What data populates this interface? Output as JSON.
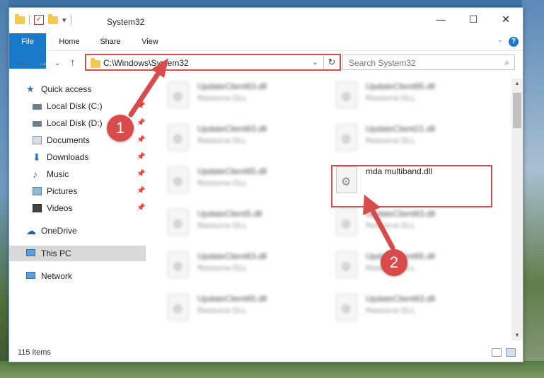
{
  "window": {
    "title": "System32",
    "minimize_glyph": "—",
    "maximize_glyph": "☐",
    "close_glyph": "✕",
    "qat_dropdown_glyph": "▾",
    "qat_check_glyph": "✓"
  },
  "ribbon": {
    "tabs": [
      "File",
      "Home",
      "Share",
      "View"
    ],
    "collapse_glyph": "⌄",
    "help_glyph": "?"
  },
  "nav": {
    "back_glyph": "←",
    "forward_glyph": "→",
    "dropdown_glyph": "⌄",
    "up_glyph": "↑",
    "address": "C:\\Windows\\System32",
    "address_dropdown_glyph": "⌄",
    "refresh_glyph": "↻",
    "search_placeholder": "Search System32",
    "search_glyph": "⌕"
  },
  "sidebar": {
    "items": [
      {
        "label": "Quick access",
        "icon": "star-icon",
        "pinned": false
      },
      {
        "label": "Local Disk (C:)",
        "icon": "drive-icon",
        "pinned": true
      },
      {
        "label": "Local Disk (D:)",
        "icon": "drive-icon",
        "pinned": true
      },
      {
        "label": "Documents",
        "icon": "documents-icon",
        "pinned": true
      },
      {
        "label": "Downloads",
        "icon": "download-icon",
        "pinned": true
      },
      {
        "label": "Music",
        "icon": "music-icon",
        "pinned": true
      },
      {
        "label": "Pictures",
        "icon": "pictures-icon",
        "pinned": true
      },
      {
        "label": "Videos",
        "icon": "videos-icon",
        "pinned": true
      },
      {
        "label": "OneDrive",
        "icon": "cloud-icon",
        "pinned": false
      },
      {
        "label": "This PC",
        "icon": "computer-icon",
        "pinned": false,
        "selected": true
      },
      {
        "label": "Network",
        "icon": "network-icon",
        "pinned": false
      }
    ],
    "pin_glyph": "📌"
  },
  "files": [
    {
      "name": "UpdateClient63.dll",
      "type": "Resource DLL"
    },
    {
      "name": "UpdateClient65.dll",
      "type": "Resource DLL"
    },
    {
      "name": "UpdateClient63.dll",
      "type": "Resource DLL"
    },
    {
      "name": "UpdateClient21.dll",
      "type": "Resource DLL"
    },
    {
      "name": "UpdateClient65.dll",
      "type": "Resource DLL"
    },
    {
      "name": "mda multiband.dll",
      "type": ""
    },
    {
      "name": "UpdateClient5.dll",
      "type": "Resource DLL"
    },
    {
      "name": "UpdateClient63.dll",
      "type": "Resource DLL"
    },
    {
      "name": "UpdateClient63.dll",
      "type": "Resource DLL"
    },
    {
      "name": "UpdateClient65.dll",
      "type": "Resource DLL"
    },
    {
      "name": "UpdateClient65.dll",
      "type": "Resource DLL"
    },
    {
      "name": "UpdateClient63.dll",
      "type": "Resource DLL"
    }
  ],
  "status": {
    "item_count": "115 items"
  },
  "annotations": {
    "marker_1": "1",
    "marker_2": "2",
    "color": "#d94a4a"
  },
  "colors": {
    "accent": "#1979ca",
    "highlight_border": "#d94a4a"
  }
}
